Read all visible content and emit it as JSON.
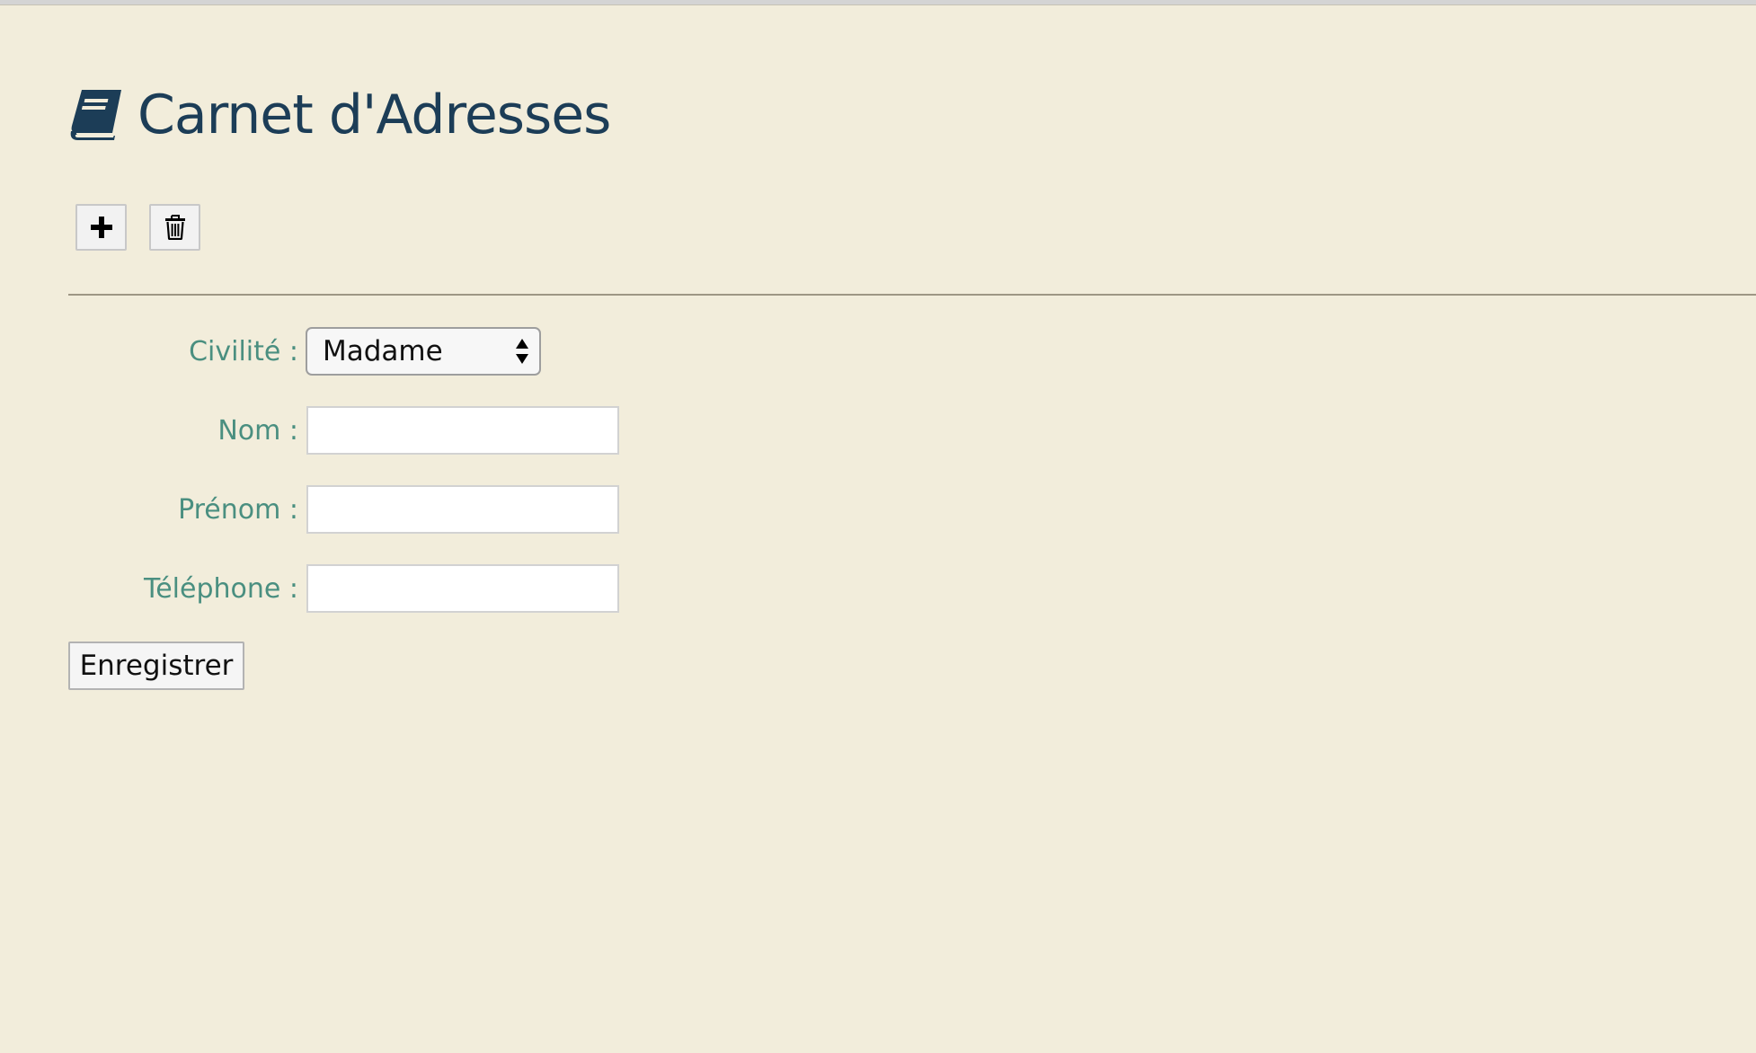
{
  "header": {
    "title": "Carnet d'Adresses",
    "icon": "book-icon"
  },
  "toolbar": {
    "add_icon": "plus-icon",
    "delete_icon": "trash-icon"
  },
  "form": {
    "civility": {
      "label": "Civilité :",
      "value": "Madame"
    },
    "last_name": {
      "label": "Nom :",
      "value": ""
    },
    "first_name": {
      "label": "Prénom :",
      "value": ""
    },
    "phone": {
      "label": "Téléphone :",
      "value": ""
    },
    "save_label": "Enregistrer"
  },
  "colors": {
    "background": "#f2eddb",
    "title": "#1c3d57",
    "label": "#4a8f80",
    "divider": "#9d9785"
  }
}
